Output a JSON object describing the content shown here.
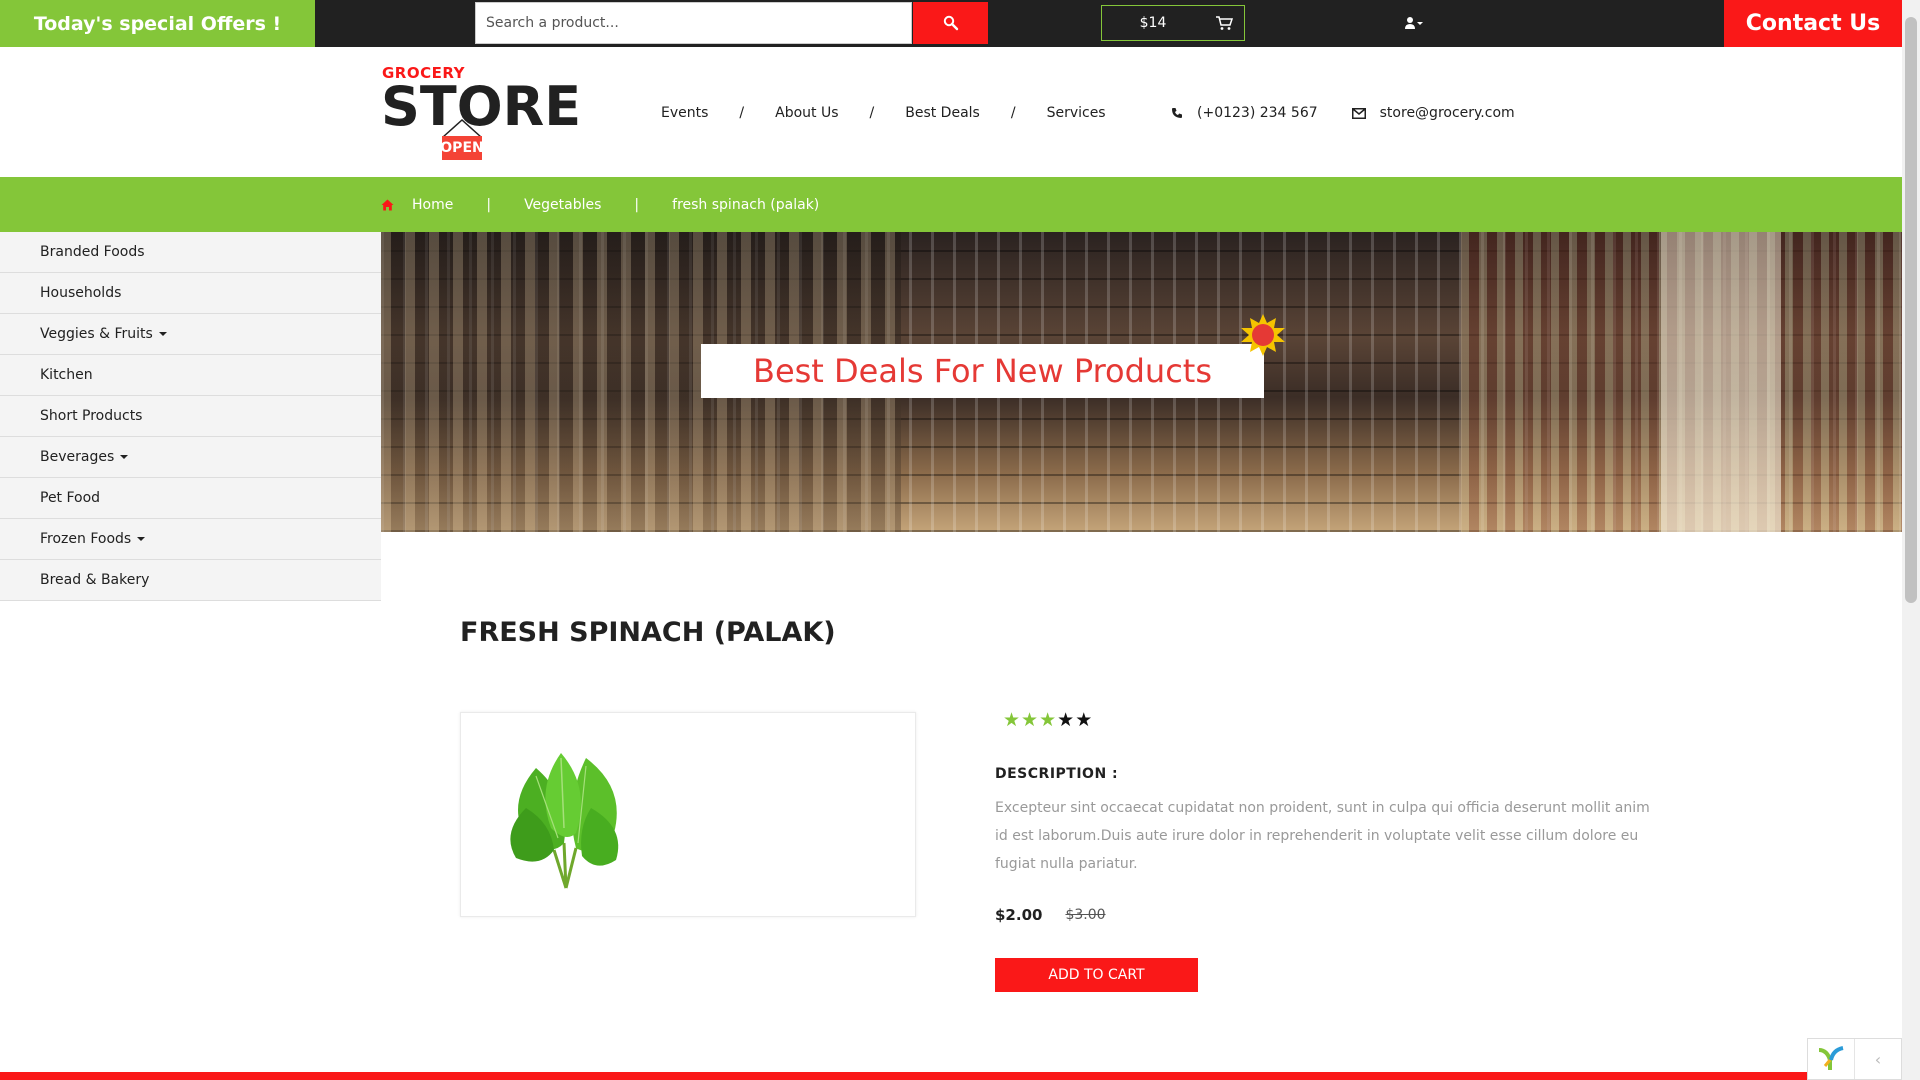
{
  "topbar": {
    "offer_text": "Today's special Offers !",
    "search_placeholder": "Search a product...",
    "cart_total": "$14",
    "contact_label": "Contact Us",
    "colors": {
      "green": "#84c639",
      "red": "#fa1818",
      "dark": "#212121"
    }
  },
  "logo": {
    "top_text": "GROCERY",
    "main_text": "STORE",
    "sign_text": "OPEN"
  },
  "nav": {
    "items": [
      "Events",
      "About Us",
      "Best Deals",
      "Services"
    ],
    "separator": "/"
  },
  "contact_info": {
    "phone": "(+0123) 234 567",
    "email": "store@grocery.com"
  },
  "breadcrumb": {
    "home": "Home",
    "category": "Vegetables",
    "current": "fresh spinach (palak)",
    "separator": "|"
  },
  "sidebar": {
    "items": [
      {
        "label": "Branded Foods",
        "has_dropdown": false
      },
      {
        "label": "Households",
        "has_dropdown": false
      },
      {
        "label": "Veggies & Fruits",
        "has_dropdown": true
      },
      {
        "label": "Kitchen",
        "has_dropdown": false
      },
      {
        "label": "Short Products",
        "has_dropdown": false
      },
      {
        "label": "Beverages",
        "has_dropdown": true
      },
      {
        "label": "Pet Food",
        "has_dropdown": false
      },
      {
        "label": "Frozen Foods",
        "has_dropdown": true
      },
      {
        "label": "Bread & Bakery",
        "has_dropdown": false
      }
    ]
  },
  "banner": {
    "headline": "Best Deals For New Products"
  },
  "product": {
    "title": "FRESH SPINACH (PALAK)",
    "rating": 3,
    "rating_max": 5,
    "description_label": "DESCRIPTION :",
    "description": "Excepteur sint occaecat cupidatat non proident, sunt in culpa qui officia deserunt mollit anim id est laborum.Duis aute irure dolor in reprehenderit in voluptate velit esse cillum dolore eu fugiat nulla pariatur.",
    "price_now": "$2.00",
    "price_was": "$3.00",
    "add_to_cart": "ADD TO CART"
  },
  "icons": {
    "search": "search-icon",
    "cart": "cart-icon",
    "user": "user-icon",
    "phone": "phone-icon",
    "email": "envelope-icon",
    "home": "home-icon",
    "star": "star-icon",
    "caret": "caret-down-icon"
  }
}
